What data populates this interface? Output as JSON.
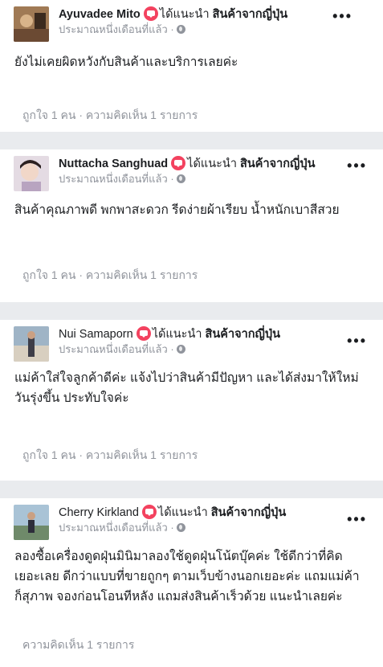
{
  "posts": [
    {
      "name": "Ayuvadee Mito",
      "recommends": "ได้แนะนำ",
      "page": "สินค้าจากญี่ปุ่น",
      "time": "ประมาณหนึ่งเดือนที่แล้ว ·",
      "more": "•••",
      "text": "ยังไม่เคยผิดหวังกับสินค้าและบริการเลยค่ะ",
      "footer": "ถูกใจ 1 คน · ความคิดเห็น 1 รายการ",
      "avatar_color": "#8b6b4a"
    },
    {
      "name": "Nuttacha Sanghuad",
      "recommends": "ได้แนะนำ",
      "page": "สินค้าจากญี่ปุ่น",
      "time": "ประมาณหนึ่งเดือนที่แล้ว ·",
      "more": "•••",
      "text": "สินค้าคุณภาพดี พกพาสะดวก รีดง่ายผ้าเรียบ น้ำหนักเบาสีสวย",
      "footer": "ถูกใจ 1 คน · ความคิดเห็น 1 รายการ",
      "avatar_color": "#c9b7c6"
    },
    {
      "name": "Nui Samaporn",
      "recommends": "ได้แนะนำ",
      "page": "สินค้าจากญี่ปุ่น",
      "time": "ประมาณหนึ่งเดือนที่แล้ว ·",
      "more": "•••",
      "text_lines": [
        "แม่ค้าใส่ใจลูกค้าดีค่ะ แจ้งไปว่าสินค้ามีปัญหา และได้ส่งมาให้ใหม่",
        "วันรุ่งขึ้น ประทับใจค่ะ"
      ],
      "footer": "ถูกใจ 1 คน · ความคิดเห็น 1 รายการ",
      "avatar_color": "#7a8fa3"
    },
    {
      "name": "Cherry Kirkland",
      "recommends": "ได้แนะนำ",
      "page": "สินค้าจากญี่ปุ่น",
      "time": "ประมาณหนึ่งเดือนที่แล้ว ·",
      "more": "•••",
      "text_lines": [
        "ลองซื้อเครื่องดูดฝุ่นมินิมาลองใช้ดูดฝุ่นโน้ตบุ๊คค่ะ ใช้ดีกว่าที่คิด",
        "เยอะเลย ดีกว่าแบบที่ขายถูกๆ ตามเว็บข้างนอกเยอะค่ะ แถมแม่ค้า",
        "ก็สุภาพ จองก่อนโอนทีหลัง แถมส่งสินค้าเร็วด้วย แนะนำเลยค่ะ"
      ],
      "footer": "ความคิดเห็น 1 รายการ",
      "avatar_color": "#6f8a6a"
    }
  ]
}
